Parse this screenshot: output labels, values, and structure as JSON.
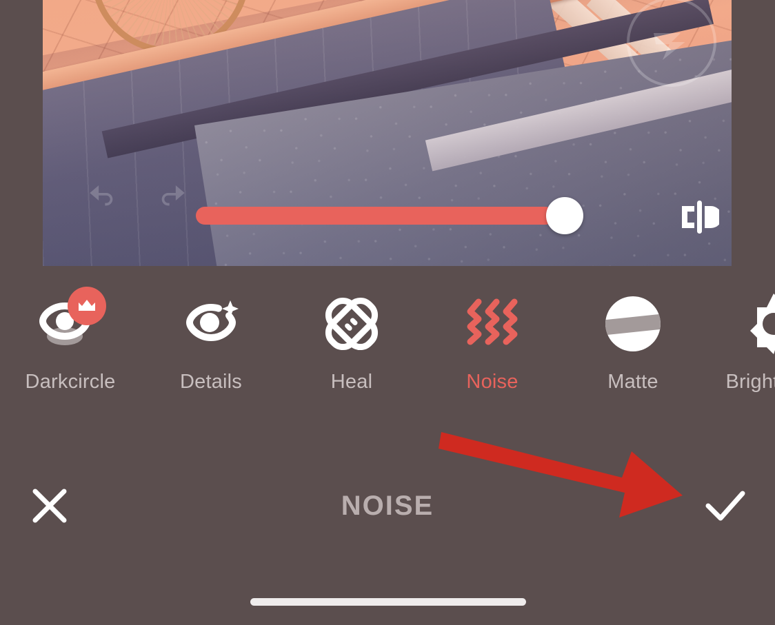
{
  "app": {
    "screen_name": "photo-editor-retouch",
    "theme": {
      "panel_bg": "#5b4e4e",
      "accent": "#e8635c",
      "label_color": "#c8bfbf",
      "annotation_arrow": "#cf2a20",
      "thumb_color": "#ffffff"
    }
  },
  "canvas": {
    "watermark_icon": "lightning-circle-watermark",
    "history": [
      {
        "name": "undo-icon",
        "label": "Undo"
      },
      {
        "name": "redo-icon",
        "label": "Redo"
      }
    ],
    "slider": {
      "name": "noise-intensity-slider",
      "value": 100,
      "min": 0,
      "max": 100,
      "fill_color": "#e8635c",
      "thumb_color": "#ffffff"
    },
    "compare_button": {
      "icon": "compare-before-after-icon",
      "label": "Compare"
    },
    "photo_description": "Street pavement with brick sidewalk, kerb and asphalt road"
  },
  "toolbar": {
    "tools": [
      {
        "label": "Darkcircle",
        "icon": "eye-darkcircle-icon",
        "active": false,
        "pro": true,
        "badge_icon": "crown-icon"
      },
      {
        "label": "Details",
        "icon": "eye-sparkle-icon",
        "active": false,
        "pro": false,
        "badge_icon": ""
      },
      {
        "label": "Heal",
        "icon": "bandage-cross-icon",
        "active": false,
        "pro": false,
        "badge_icon": ""
      },
      {
        "label": "Noise",
        "icon": "wavy-lines-icon",
        "active": true,
        "pro": false,
        "badge_icon": ""
      },
      {
        "label": "Matte",
        "icon": "circle-band-icon",
        "active": false,
        "pro": false,
        "badge_icon": ""
      },
      {
        "label": "Brightness",
        "icon": "sun-icon",
        "active": false,
        "pro": false,
        "badge_icon": ""
      }
    ]
  },
  "action_bar": {
    "cancel": {
      "label": "Cancel",
      "icon": "close-x-icon"
    },
    "title": "NOISE",
    "confirm": {
      "label": "Apply",
      "icon": "checkmark-icon"
    }
  },
  "annotation": {
    "arrow_icon": "red-pointer-arrow",
    "points_to": "confirm-apply-button"
  },
  "system": {
    "home_indicator": "home-indicator-bar"
  }
}
